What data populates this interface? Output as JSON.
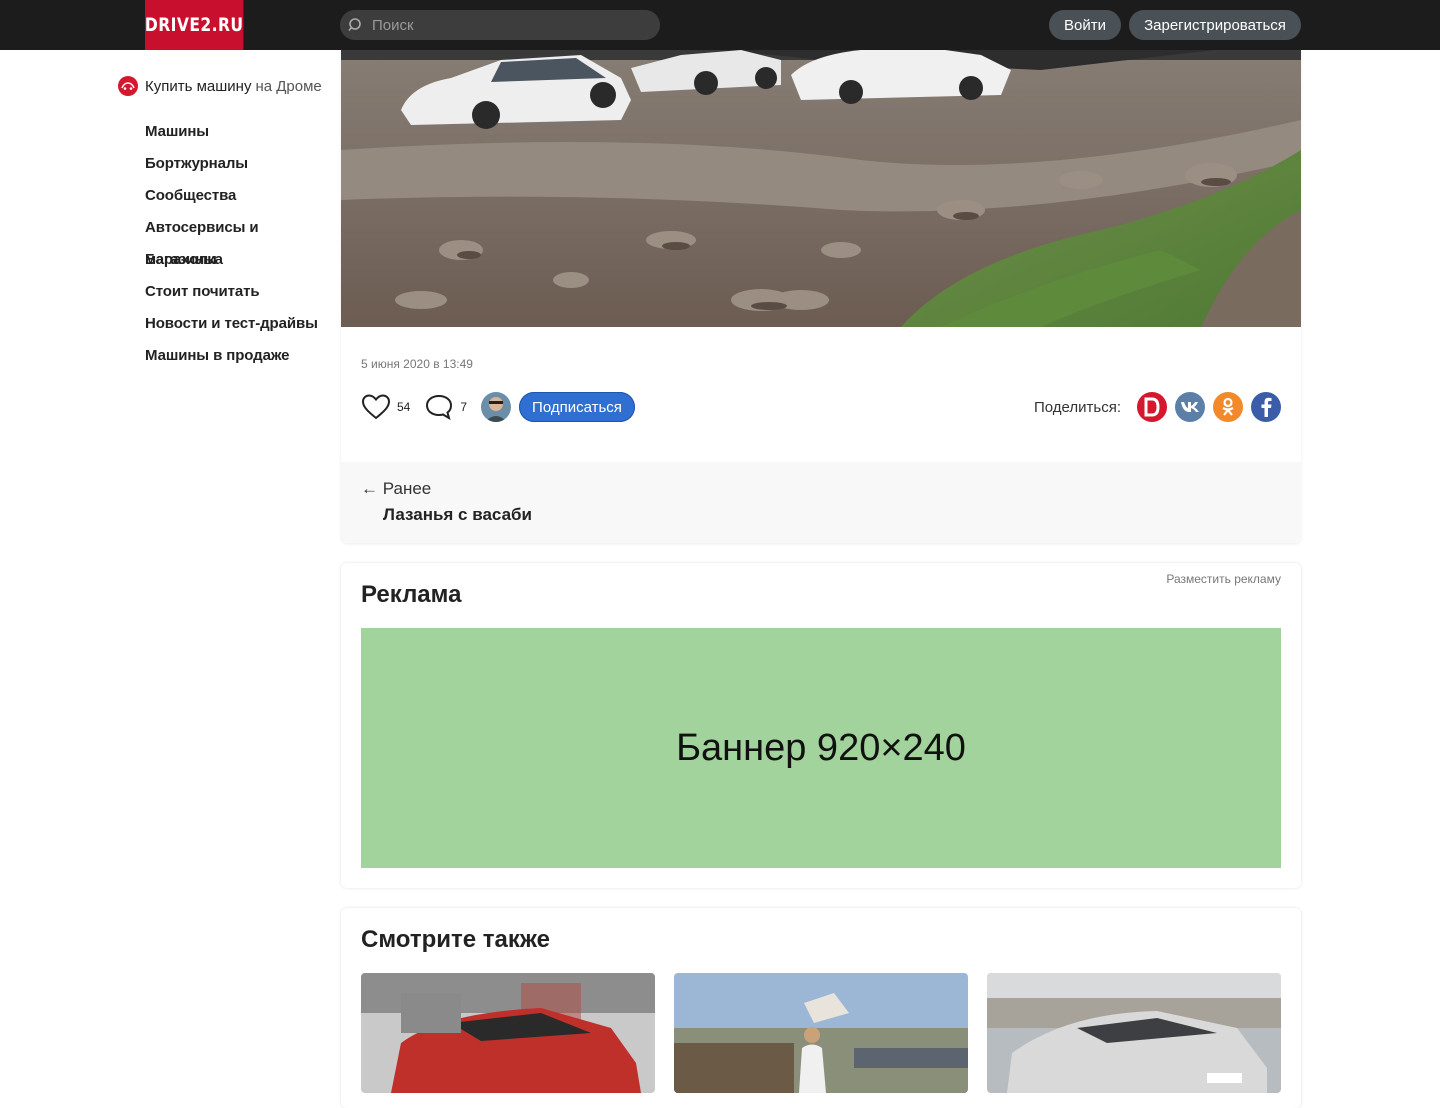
{
  "header": {
    "logo": "DRIVE2.RU",
    "search_placeholder": "Поиск",
    "login": "Войти",
    "register": "Зарегистрироваться"
  },
  "sidebar": {
    "buy_bold": "Купить машину",
    "buy_rest": "на Дроме",
    "items": [
      {
        "label": "Машины"
      },
      {
        "label": "Бортжурналы"
      },
      {
        "label": "Сообщества"
      },
      {
        "label": "Автосервисы и магазины"
      },
      {
        "label": "Барахолка"
      },
      {
        "label": "Стоит почитать"
      },
      {
        "label": "Новости и тест-драйвы"
      },
      {
        "label": "Машины в продаже"
      }
    ]
  },
  "post": {
    "date": "5 июня 2020 в 13:49",
    "likes": "54",
    "comments": "7",
    "subscribe": "Подписаться",
    "share_label": "Поделиться:",
    "share_icons": [
      "drive2-icon",
      "vk-icon",
      "odnoklassniki-icon",
      "facebook-icon"
    ],
    "prev_label": "← Ранее",
    "prev_title": "Лазанья с васаби"
  },
  "ad": {
    "title": "Реклама",
    "place": "Разместить рекламу",
    "banner": "Баннер 920×240"
  },
  "see_also": {
    "title": "Смотрите также"
  },
  "colors": {
    "topbar": "#1c1c1c",
    "brand": "#c8102e",
    "subscribe": "#2f6fd1",
    "banner": "#a2d39c"
  }
}
